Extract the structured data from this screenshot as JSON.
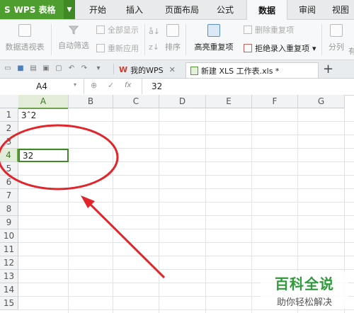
{
  "app": {
    "logo_text": "WPS 表格"
  },
  "menu": {
    "tabs": [
      "开始",
      "插入",
      "页面布局",
      "公式",
      "数据",
      "审阅",
      "视图"
    ],
    "active": "数据"
  },
  "ribbon": {
    "pivot": "数据透视表",
    "autofilter": "自动筛选",
    "show_all": "全部显示",
    "reapply": "重新应用",
    "sort": "排序",
    "highlight_dup": "高亮重复项",
    "delete_dup": "删除重复项",
    "reject_dup": "拒绝录入重复项",
    "split": "分列",
    "more": "有"
  },
  "doctabs": {
    "wps": "我的WPS",
    "file": "新建 XLS 工作表.xls *",
    "add": "+"
  },
  "formula_bar": {
    "name_box": "A4",
    "fx": "fx",
    "value": "32"
  },
  "columns": [
    "A",
    "B",
    "C",
    "D",
    "E",
    "F",
    "G"
  ],
  "rows": [
    "1",
    "2",
    "3",
    "4",
    "5",
    "6",
    "7",
    "8",
    "9",
    "10",
    "11",
    "12",
    "13",
    "14",
    "15"
  ],
  "cells": {
    "A1": "3ˆ2",
    "A4": "32"
  },
  "watermark": {
    "title": "百科全说",
    "subtitle": "助你轻松解决"
  },
  "colors": {
    "brand_green": "#4d9d2f",
    "annotation_red": "#e0262b"
  }
}
